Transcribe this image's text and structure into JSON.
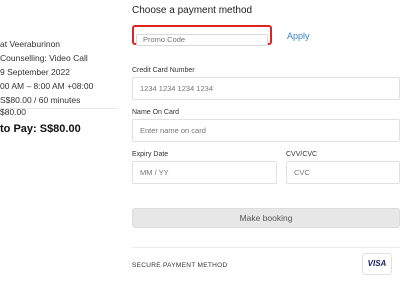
{
  "booking_summary": {
    "counsellor_name": "at Veeraburinon",
    "counselling_type": "Counselling: Video Call",
    "date": "9 September 2022",
    "time": "00 AM – 8:00 AM +08:00",
    "price_duration": "S$80.00 / 60 minutes",
    "subtotal": "$80.00",
    "total": "to Pay: S$80.00"
  },
  "payment": {
    "heading": "Choose a payment method",
    "promo_placeholder": "Promo Code",
    "apply_label": "Apply",
    "card_number_label": "Credit Card Number",
    "card_number_placeholder": "1234 1234 1234 1234",
    "name_label": "Name On Card",
    "name_placeholder": "Enter name on card",
    "expiry_label": "Expiry Date",
    "expiry_placeholder": "MM / YY",
    "cvv_label": "CVV/CVC",
    "cvv_placeholder": "CVC",
    "submit_label": "Make booking",
    "secure_label": "SECURE PAYMENT METHOD",
    "card_brand": "VISA"
  }
}
